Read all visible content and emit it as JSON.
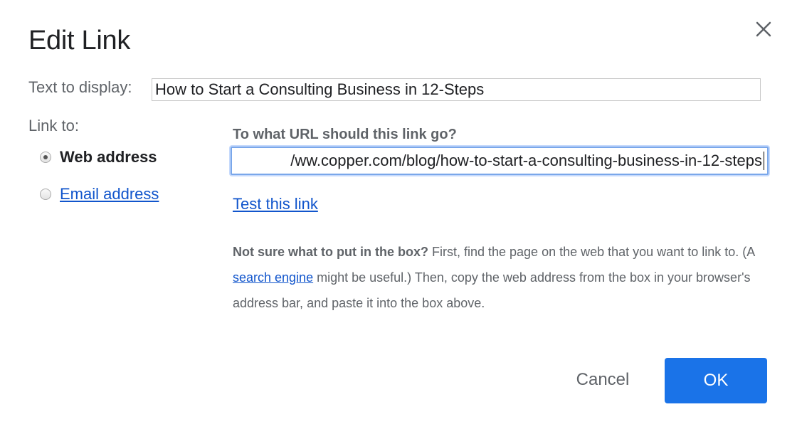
{
  "dialog": {
    "title": "Edit Link",
    "close_icon": "close-icon"
  },
  "display_text": {
    "label": "Text to display:",
    "value": "How to Start a Consulting Business in 12-Steps"
  },
  "link_to": {
    "label": "Link to:",
    "options": [
      {
        "label": "Web address",
        "selected": true
      },
      {
        "label": "Email address",
        "selected": false
      }
    ]
  },
  "url": {
    "heading": "To what URL should this link go?",
    "value": "/ww.copper.com/blog/how-to-start-a-consulting-business-in-12-steps",
    "test_link": "Test this link"
  },
  "help": {
    "bold": "Not sure what to put in the box?",
    "part1": " First, find the page on the web that you want to link to. (A ",
    "link": "search engine",
    "part2": " might be useful.) Then, copy the web address from the box in your browser's address bar, and paste it into the box above."
  },
  "buttons": {
    "cancel": "Cancel",
    "ok": "OK"
  },
  "colors": {
    "primary": "#1a73e8",
    "link": "#1155cc",
    "focus_border": "#7aa7ea"
  }
}
